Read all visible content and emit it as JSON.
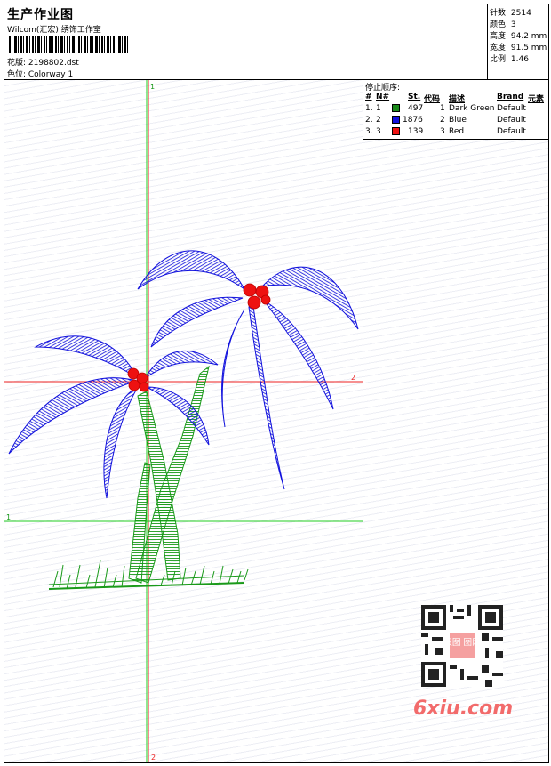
{
  "header": {
    "title": "生产作业图",
    "company": "Wilcom(汇宏) 绣饰工作室",
    "file_label": "花版: 2198802.dst",
    "colorway_label": "色位:  Colorway 1"
  },
  "stats": [
    {
      "label": "针数: 2514"
    },
    {
      "label": "颜色: 3"
    },
    {
      "label": "高度: 94.2 mm"
    },
    {
      "label": "宽度: 91.5 mm"
    },
    {
      "label": "比例: 1.46"
    }
  ],
  "stop_sequence": {
    "title": "停止顺序:",
    "headers": [
      "#",
      "N#",
      "St.",
      "代码",
      "描述",
      "Brand",
      "元素"
    ],
    "rows": [
      {
        "idx": "1.",
        "n": "1",
        "st": "497",
        "code": "1",
        "desc": "Dark Green",
        "brand": "Default",
        "color": "#1a8a1a"
      },
      {
        "idx": "2.",
        "n": "2",
        "st": "1876",
        "code": "2",
        "desc": "Blue",
        "brand": "Default",
        "color": "#1111dd"
      },
      {
        "idx": "3.",
        "n": "3",
        "st": "139",
        "code": "3",
        "desc": "Red",
        "brand": "Default",
        "color": "#ee1111"
      }
    ]
  },
  "canvas": {
    "marker_1_top": "1",
    "marker_1_left": "1",
    "marker_2_right": "2",
    "marker_2_bottom": "2",
    "colors": {
      "green": "#1a9a1a",
      "blue": "#1111dd",
      "red": "#ee1111",
      "guide_green": "#22cc22",
      "guide_red": "#ee2222"
    }
  },
  "watermark": {
    "badge": "汉图 图网",
    "site": "6xiu.com"
  }
}
